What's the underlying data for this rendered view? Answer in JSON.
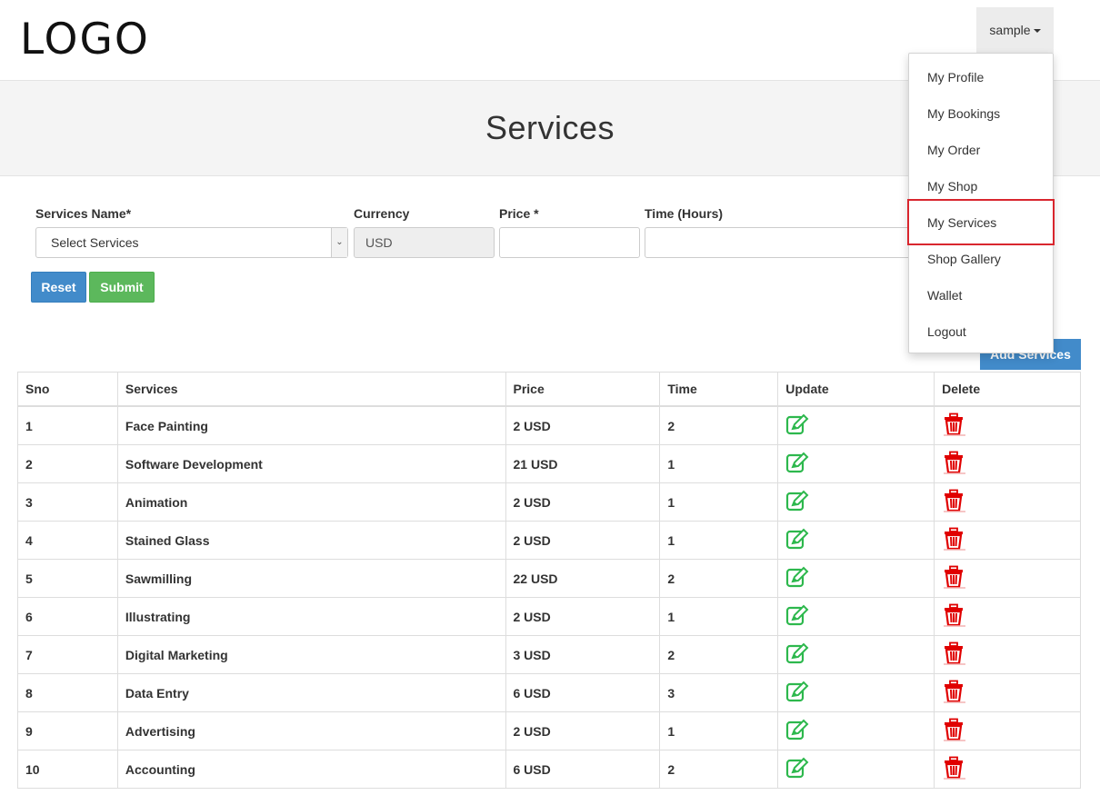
{
  "header": {
    "logo_text": "LOGO",
    "user_menu_label": "sample"
  },
  "page": {
    "title": "Services"
  },
  "form": {
    "service_name_label": "Services Name*",
    "service_select_value": "Select Services",
    "currency_label": "Currency",
    "currency_value": "USD",
    "price_label": "Price *",
    "price_value": "",
    "time_label": "Time (Hours)",
    "time_value": "",
    "reset_label": "Reset",
    "submit_label": "Submit"
  },
  "add_services_label": "Add Services",
  "table": {
    "columns": [
      "Sno",
      "Services",
      "Price",
      "Time",
      "Update",
      "Delete"
    ],
    "rows": [
      {
        "sno": "1",
        "service": "Face Painting",
        "price": "2 USD",
        "time": "2"
      },
      {
        "sno": "2",
        "service": "Software Development",
        "price": "21 USD",
        "time": "1"
      },
      {
        "sno": "3",
        "service": "Animation",
        "price": "2 USD",
        "time": "1"
      },
      {
        "sno": "4",
        "service": "Stained Glass",
        "price": "2 USD",
        "time": "1"
      },
      {
        "sno": "5",
        "service": "Sawmilling",
        "price": "22 USD",
        "time": "2"
      },
      {
        "sno": "6",
        "service": "Illustrating",
        "price": "2 USD",
        "time": "1"
      },
      {
        "sno": "7",
        "service": "Digital Marketing",
        "price": "3 USD",
        "time": "2"
      },
      {
        "sno": "8",
        "service": "Data Entry",
        "price": "6 USD",
        "time": "3"
      },
      {
        "sno": "9",
        "service": "Advertising",
        "price": "2 USD",
        "time": "1"
      },
      {
        "sno": "10",
        "service": "Accounting",
        "price": "6 USD",
        "time": "2"
      }
    ],
    "update_icon": "edit-icon",
    "delete_icon": "trash-icon"
  },
  "dropdown": {
    "items": [
      "My Profile",
      "My Bookings",
      "My Order",
      "My Shop",
      "My Services",
      "Shop Gallery",
      "Wallet",
      "Logout"
    ],
    "highlighted_index": 4
  },
  "colors": {
    "primary": "#428bca",
    "success": "#5cb85c",
    "edit_icon": "#2db84d",
    "delete_icon": "#e00000",
    "highlight_border": "#d9262e"
  }
}
